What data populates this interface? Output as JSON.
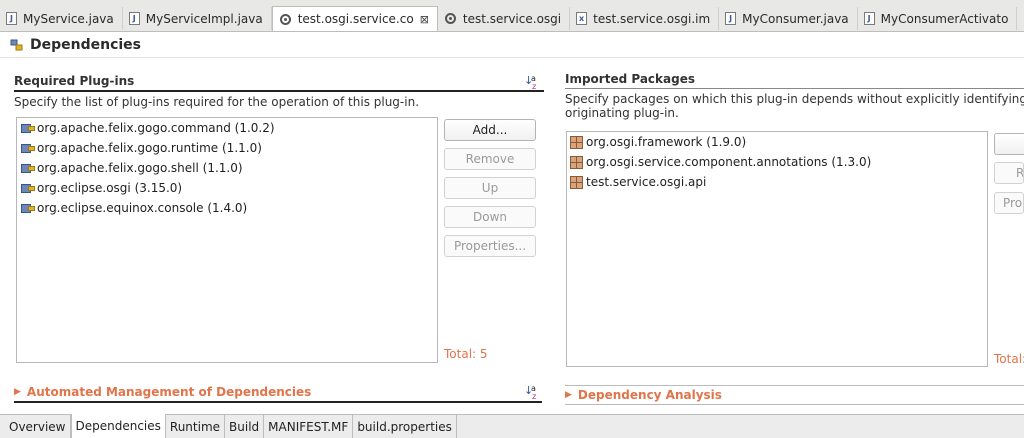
{
  "editor_tabs": [
    {
      "label": "MyService.java",
      "icon": "java-file-icon",
      "active": false
    },
    {
      "label": "MyServiceImpl.java",
      "icon": "java-file-icon",
      "active": false
    },
    {
      "label": "test.osgi.service.co",
      "icon": "plugin-manifest-icon",
      "active": true
    },
    {
      "label": "test.service.osgi",
      "icon": "plugin-manifest-icon",
      "active": false
    },
    {
      "label": "test.service.osgi.im",
      "icon": "xml-file-icon",
      "active": false
    },
    {
      "label": "MyConsumer.java",
      "icon": "java-file-icon",
      "active": false
    },
    {
      "label": "MyConsumerActivato",
      "icon": "java-file-icon",
      "active": false
    }
  ],
  "header": {
    "title": "Dependencies"
  },
  "required_plugins": {
    "title": "Required Plug-ins",
    "description": "Specify the list of plug-ins required for the operation of this plug-in.",
    "items": [
      "org.apache.felix.gogo.command (1.0.2)",
      "org.apache.felix.gogo.runtime (1.1.0)",
      "org.apache.felix.gogo.shell (1.1.0)",
      "org.eclipse.osgi (3.15.0)",
      "org.eclipse.equinox.console (1.4.0)"
    ],
    "buttons": {
      "add": "Add...",
      "remove": "Remove",
      "up": "Up",
      "down": "Down",
      "properties": "Properties..."
    },
    "total": "Total: 5"
  },
  "imported_packages": {
    "title": "Imported Packages",
    "description_line1": "Specify packages on which this plug-in depends without explicitly identifying the",
    "description_line2": "originating plug-in.",
    "items": [
      "org.osgi.framework (1.9.0)",
      "org.osgi.service.component.annotations (1.3.0)",
      "test.service.osgi.api"
    ],
    "buttons": {
      "add": "A",
      "remove": "R",
      "properties": "Pro"
    },
    "total": "Total:"
  },
  "automated_management": {
    "title": "Automated Management of Dependencies"
  },
  "dependency_analysis": {
    "title": "Dependency Analysis"
  },
  "bottom_tabs": [
    {
      "label": "Overview",
      "active": false
    },
    {
      "label": "Dependencies",
      "active": true
    },
    {
      "label": "Runtime",
      "active": false
    },
    {
      "label": "Build",
      "active": false
    },
    {
      "label": "MANIFEST.MF",
      "active": false
    },
    {
      "label": "build.properties",
      "active": false
    }
  ],
  "colors": {
    "accent": "#e2744a",
    "section_rule": "#222222"
  }
}
